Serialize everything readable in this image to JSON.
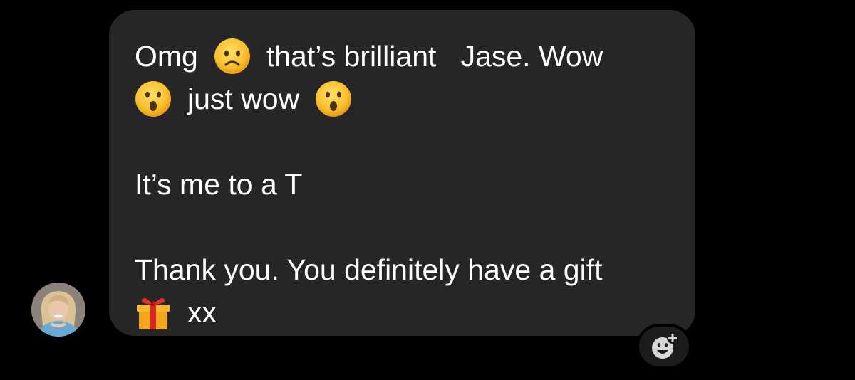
{
  "message": {
    "line1": {
      "word1": "Omg",
      "phrase": "that’s brilliant   Jase. Wow"
    },
    "line2": {
      "text": "just wow"
    },
    "line3": {
      "text": "It’s me to a T"
    },
    "line4": {
      "text": "Thank you. You definitely have a gift"
    },
    "line5": {
      "text": "xx"
    }
  },
  "emojis": {
    "frowning": "frowning-face-emoji",
    "surprised": "face-with-open-mouth-emoji",
    "gift": "wrapped-gift-emoji"
  },
  "icons": {
    "avatar": "sender-avatar",
    "reaction": "add-reaction-icon"
  },
  "colors": {
    "background": "#000000",
    "bubble": "#262628",
    "text": "#ffffff",
    "reaction_button": "#1c1c1e"
  }
}
